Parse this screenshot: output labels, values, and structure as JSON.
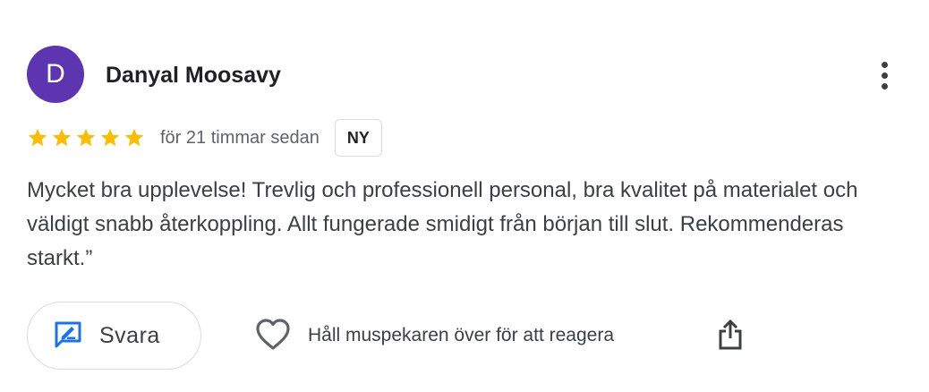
{
  "review": {
    "avatar_letter": "D",
    "author": "Danyal Moosavy",
    "rating": 5,
    "max_rating": 5,
    "time": "för 21 timmar sedan",
    "badge": "NY",
    "text": "Mycket bra upplevelse! Trevlig och professionell personal, bra kvalitet på materialet och väldigt snabb återkoppling. Allt fungerade smidigt från början till slut. Rekommenderas starkt.”"
  },
  "actions": {
    "reply_label": "Svara",
    "react_label": "Håll muspekaren över för att reagera"
  },
  "icons": {
    "more": "more-vert-icon",
    "star": "star-icon",
    "reply": "reply-edit-icon",
    "heart": "heart-outline-icon",
    "share": "share-icon"
  },
  "colors": {
    "avatar_bg": "#5e35b1",
    "star": "#fbbc04",
    "reply_icon": "#1a73e8"
  }
}
